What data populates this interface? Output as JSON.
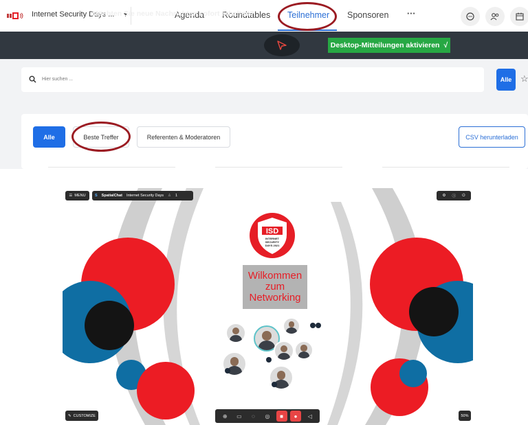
{
  "topnav": {
    "event_name": "Internet Security Days ...",
    "tabs": [
      {
        "label": "Agenda",
        "active": false
      },
      {
        "label": "Roundtables",
        "active": false
      },
      {
        "label": "Teilnehmer",
        "active": true
      },
      {
        "label": "Sponsoren",
        "active": false
      },
      {
        "label": "···",
        "active": false
      }
    ],
    "icons": [
      "chat-icon",
      "people-icon",
      "calendar-icon"
    ],
    "accent_color": "#2b6fd6",
    "highlight_color": "#9b1b22"
  },
  "notification": {
    "text": "Möchten Sie neue Nachrichten sofort erhalten?",
    "button_label": "Desktop-Mitteilungen aktivieren",
    "button_check": "√",
    "button_color": "#27a844"
  },
  "search": {
    "placeholder": "Hier suchen ...",
    "filter_label": "Alle"
  },
  "filters": {
    "items": [
      "Alle",
      "Beste Treffer",
      "Referenten & Moderatoren"
    ],
    "csv_label": "CSV herunterladen"
  },
  "spatialchat": {
    "menu_label": "MENU",
    "app_name": "SpatialChat",
    "space_name": "Internet Security Days",
    "participant_count": "1",
    "logo_text": "ISD",
    "logo_caption": [
      "INTERNET",
      "SECURITY",
      "DAYS 2021"
    ],
    "welcome_lines": [
      "Wilkommen",
      "zum",
      "Networking"
    ],
    "customize_label": "CUSTOMIZE",
    "zoom_label": "50%",
    "brand_red": "#e61e26",
    "brand_blue": "#0f6ea3"
  }
}
